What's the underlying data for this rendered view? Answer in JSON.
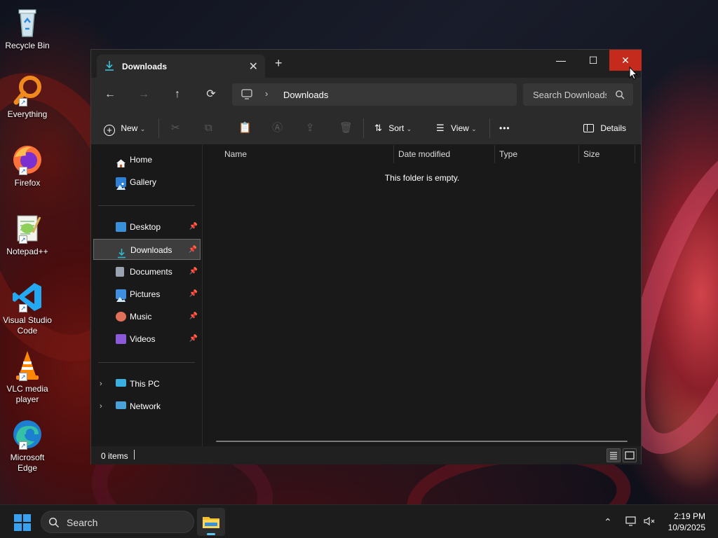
{
  "desktop": {
    "icons": [
      {
        "label": "Recycle Bin",
        "icon": "recycle-bin-icon"
      },
      {
        "label": "Everything",
        "icon": "everything-search-icon"
      },
      {
        "label": "Firefox",
        "icon": "firefox-icon"
      },
      {
        "label": "Notepad++",
        "icon": "notepad-plus-plus-icon"
      },
      {
        "label": "Visual Studio Code",
        "icon": "vscode-icon"
      },
      {
        "label": "VLC media player",
        "icon": "vlc-icon"
      },
      {
        "label": "Microsoft Edge",
        "icon": "edge-icon"
      }
    ]
  },
  "window": {
    "tab": {
      "title": "Downloads",
      "close_glyph": "✕",
      "icon": "download-icon"
    },
    "new_tab_glyph": "+",
    "controls": {
      "minimize": "—",
      "maximize": "☐",
      "close": "✕"
    },
    "nav": {
      "back": "←",
      "forward": "→",
      "up": "↑",
      "refresh": "⟳"
    },
    "address": {
      "separator": "›",
      "crumb": "Downloads"
    },
    "search": {
      "placeholder": "Search Downloads"
    },
    "commands": {
      "new": "New",
      "sort": "Sort",
      "view": "View",
      "more": "•••",
      "details": "Details"
    },
    "sidebar": {
      "top": [
        {
          "label": "Home",
          "icon": "home-icon"
        },
        {
          "label": "Gallery",
          "icon": "gallery-icon"
        }
      ],
      "pinned": [
        {
          "label": "Desktop",
          "icon": "desktop-folder-icon",
          "color": "#3a8fd9"
        },
        {
          "label": "Downloads",
          "icon": "downloads-folder-icon",
          "color": "#2fb7c9",
          "selected": true
        },
        {
          "label": "Documents",
          "icon": "documents-folder-icon",
          "color": "#9aa4b0"
        },
        {
          "label": "Pictures",
          "icon": "pictures-folder-icon",
          "color": "#3f8ee0"
        },
        {
          "label": "Music",
          "icon": "music-folder-icon",
          "color": "#e0705a"
        },
        {
          "label": "Videos",
          "icon": "videos-folder-icon",
          "color": "#8a5ad8"
        }
      ],
      "pin_glyph": "📌",
      "locations": [
        {
          "label": "This PC",
          "icon": "this-pc-icon"
        },
        {
          "label": "Network",
          "icon": "network-icon"
        }
      ],
      "expander_glyph": "›"
    },
    "columns": [
      "Name",
      "Date modified",
      "Type",
      "Size"
    ],
    "empty_message": "This folder is empty.",
    "status": {
      "item_count": "0 items"
    }
  },
  "taskbar": {
    "search_label": "Search",
    "tray_chevron": "⌃",
    "time": "2:19 PM",
    "date": "10/9/2025"
  },
  "colors": {
    "close_button": "#c42b1c",
    "accent": "#3cc1d6",
    "window_bg": "#191919",
    "toolbar_bg": "#2b2b2b"
  }
}
